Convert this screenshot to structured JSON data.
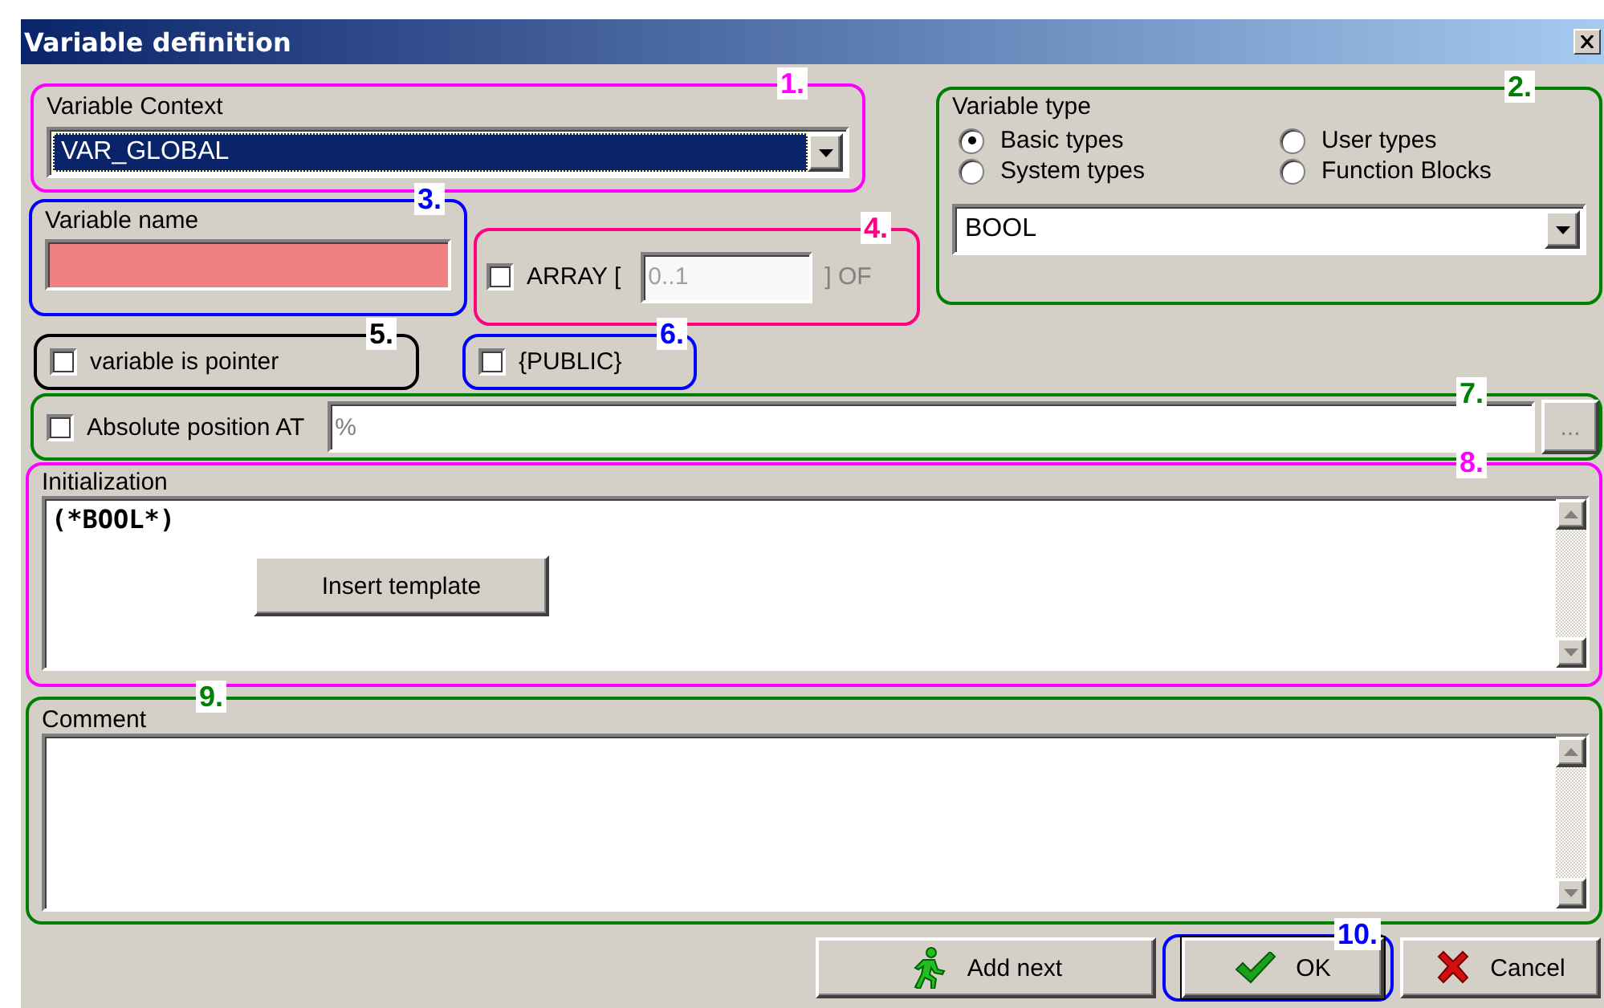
{
  "window": {
    "title": "Variable definition"
  },
  "variable_context": {
    "callout": {
      "number": "1.",
      "color": "#ff00ff"
    },
    "label": "Variable Context",
    "value": "VAR_GLOBAL",
    "highlighted": true
  },
  "variable_type": {
    "callout": {
      "number": "2.",
      "color": "#008000"
    },
    "label": "Variable type",
    "options": [
      {
        "label": "Basic types",
        "selected": true
      },
      {
        "label": "User types",
        "selected": false
      },
      {
        "label": "System types",
        "selected": false
      },
      {
        "label": "Function Blocks",
        "selected": false
      }
    ],
    "value": "BOOL"
  },
  "variable_name": {
    "callout": {
      "number": "3.",
      "color": "#0000ff"
    },
    "label": "Variable name",
    "invalid": true
  },
  "array": {
    "callout": {
      "number": "4.",
      "color": "#ff0080"
    },
    "checked": false,
    "label": "ARRAY [",
    "range": "0..1",
    "suffix": "] OF",
    "disabled": true
  },
  "pointer": {
    "callout": {
      "number": "5.",
      "color": "#000000"
    },
    "checked": false,
    "label": "variable is pointer"
  },
  "public": {
    "callout": {
      "number": "6.",
      "color": "#0000ff"
    },
    "checked": false,
    "label": "{PUBLIC}"
  },
  "absolute_position": {
    "callout": {
      "number": "7.",
      "color": "#008000"
    },
    "checked": false,
    "label": "Absolute position AT",
    "placeholder": "%",
    "browse_button": "..."
  },
  "initialization": {
    "callout": {
      "number": "8.",
      "color": "#ff00ff"
    },
    "label": "Initialization",
    "value": "(*BOOL*)",
    "template_button": "Insert template"
  },
  "comment": {
    "callout": {
      "number": "9.",
      "color": "#008000"
    },
    "label": "Comment"
  },
  "buttons": [
    {
      "kind": "add",
      "label": "Add next"
    },
    {
      "kind": "ok",
      "label": "OK",
      "callout": {
        "number": "10.",
        "color": "#0000ff"
      }
    },
    {
      "kind": "cancel",
      "label": "Cancel"
    }
  ]
}
